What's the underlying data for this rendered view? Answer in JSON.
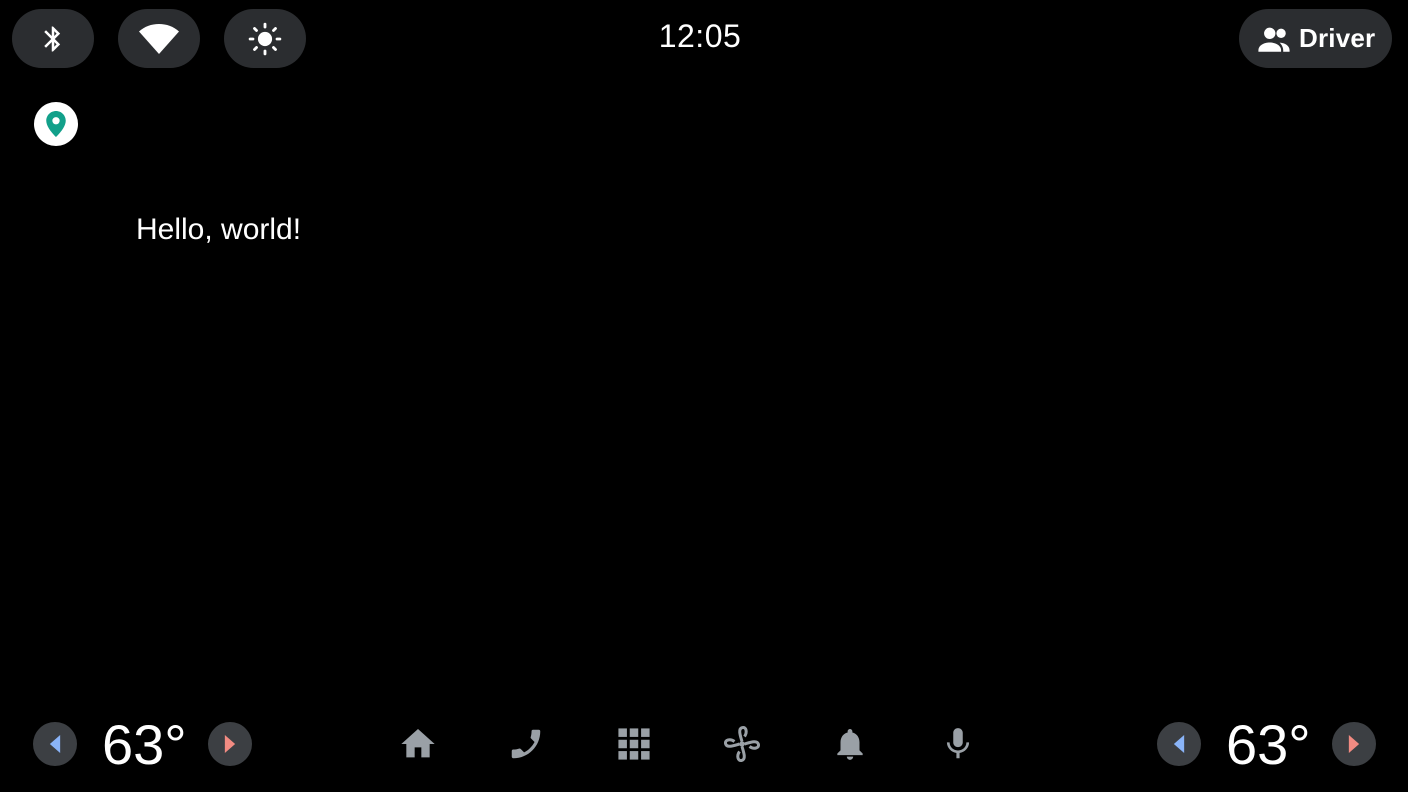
{
  "status_bar": {
    "clock": "12:05",
    "user_label": "Driver",
    "icons": [
      "bluetooth-icon",
      "wifi-icon",
      "brightness-icon",
      "people-icon"
    ]
  },
  "content": {
    "location_icon": "location-pin-icon",
    "message": "Hello, world!"
  },
  "climate": {
    "left_temperature": "63°",
    "right_temperature": "63°"
  },
  "navigation": {
    "items": [
      "home-icon",
      "phone-icon",
      "app-grid-icon",
      "fan-icon",
      "notification-bell-icon",
      "microphone-icon"
    ]
  },
  "colors": {
    "background": "#000000",
    "pill": "#2b2d30",
    "arrow_bg": "#3c3f43",
    "arrow_decrease": "#8ab4f8",
    "arrow_increase": "#f28b82",
    "nav_icon": "#9aa0a6",
    "location_pin": "#12a08a"
  }
}
